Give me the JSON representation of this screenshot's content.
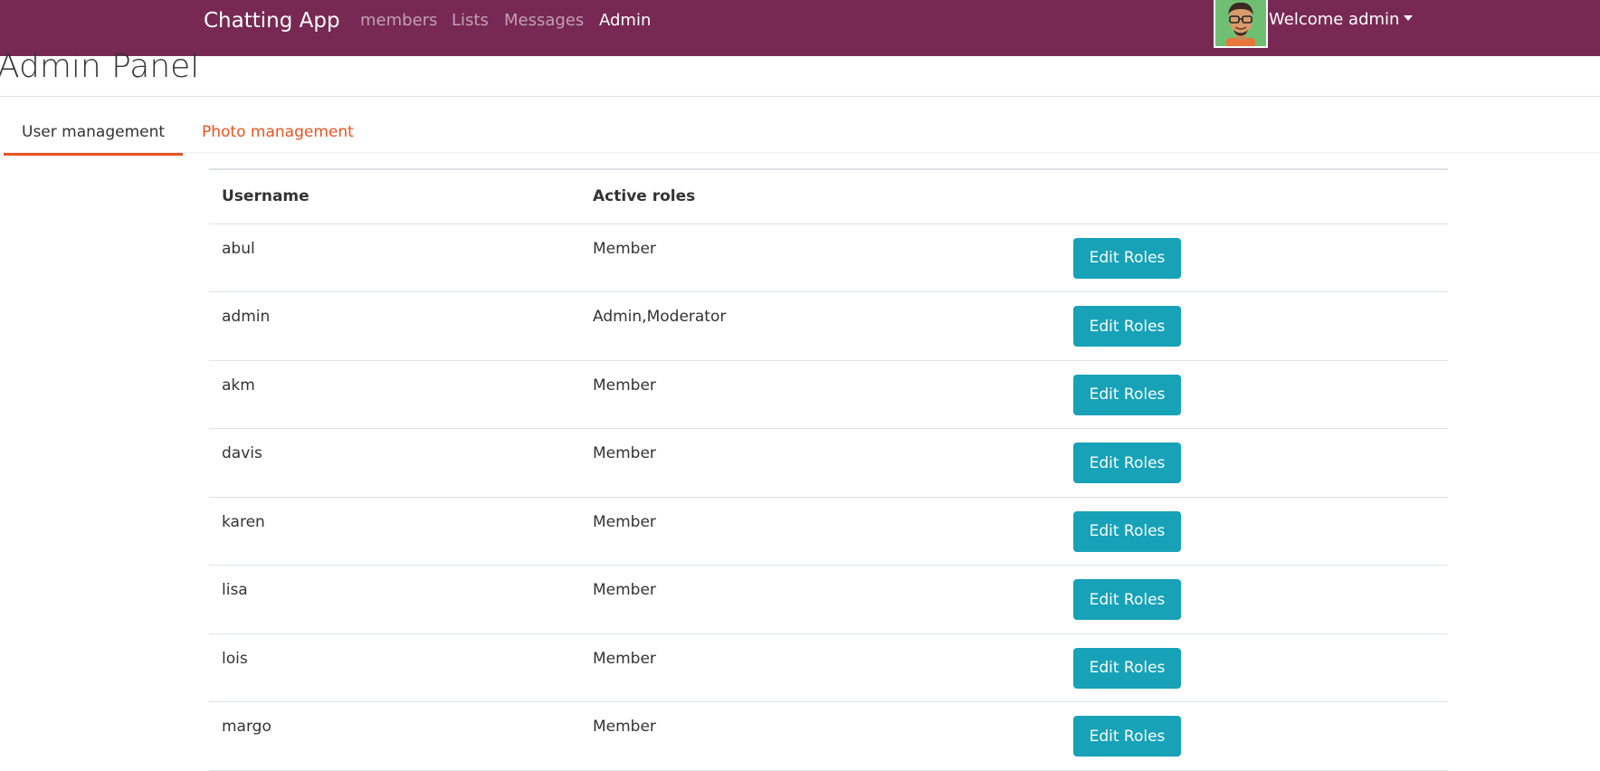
{
  "navbar": {
    "brand": "Chatting App",
    "links": [
      {
        "label": "members",
        "active": false
      },
      {
        "label": "Lists",
        "active": false
      },
      {
        "label": "Messages",
        "active": false
      },
      {
        "label": "Admin",
        "active": true
      }
    ],
    "welcome": "Welcome admin",
    "background_color": "#772953"
  },
  "page": {
    "title": "Admin Panel"
  },
  "tabs": [
    {
      "label": "User management",
      "active": true
    },
    {
      "label": "Photo management",
      "active": false
    }
  ],
  "table": {
    "headers": [
      "Username",
      "Active roles",
      ""
    ],
    "button_label": "Edit Roles",
    "rows": [
      {
        "username": "abul",
        "roles": "Member"
      },
      {
        "username": "admin",
        "roles": "Admin,Moderator"
      },
      {
        "username": "akm",
        "roles": "Member"
      },
      {
        "username": "davis",
        "roles": "Member"
      },
      {
        "username": "karen",
        "roles": "Member"
      },
      {
        "username": "lisa",
        "roles": "Member"
      },
      {
        "username": "lois",
        "roles": "Member"
      },
      {
        "username": "margo",
        "roles": "Member"
      }
    ]
  },
  "colors": {
    "accent": "#e95420",
    "button": "#17a2b8",
    "navbar": "#772953"
  }
}
